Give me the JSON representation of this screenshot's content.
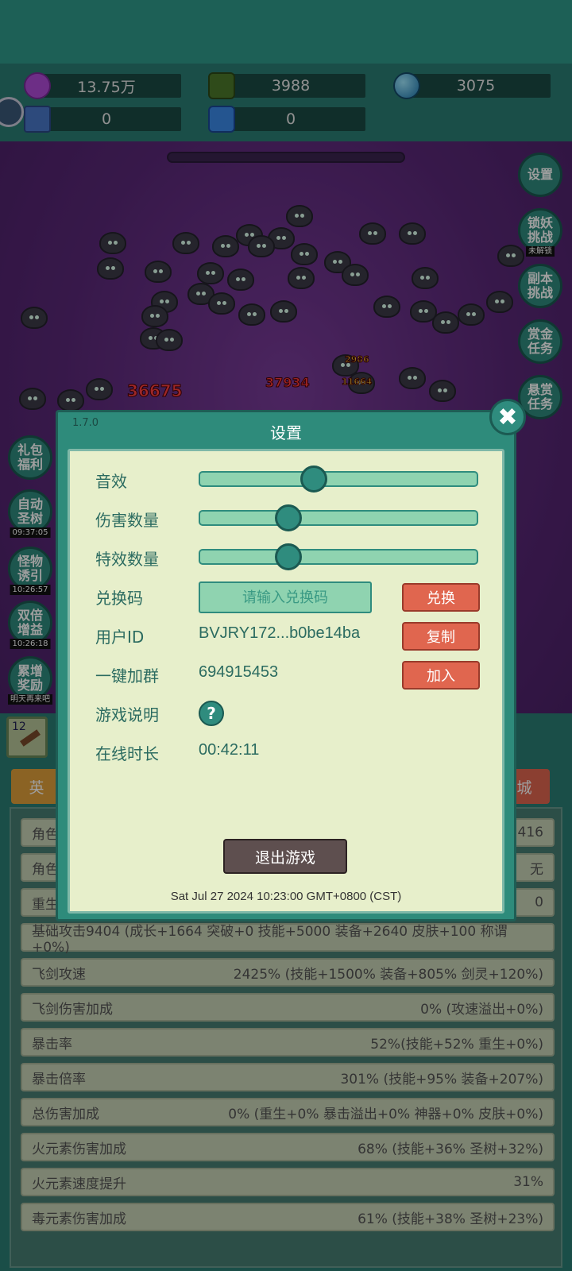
{
  "resources": {
    "gem": "13.75万",
    "green_crystal": "3988",
    "orb": "3075",
    "ticket": "0",
    "blue_crystal": "0"
  },
  "right_buttons": [
    {
      "label": "设置",
      "sub": ""
    },
    {
      "label": "锁妖\n挑战",
      "sub": "未解锁"
    },
    {
      "label": "副本\n挑战",
      "sub": ""
    },
    {
      "label": "赏金\n任务",
      "sub": ""
    },
    {
      "label": "悬赏\n任务",
      "sub": ""
    }
  ],
  "left_buttons": [
    {
      "label": "礼包\n福利",
      "sub": ""
    },
    {
      "label": "自动\n圣树",
      "sub": "09:37:05"
    },
    {
      "label": "怪物\n诱引",
      "sub": "10:26:57"
    },
    {
      "label": "双倍\n增益",
      "sub": "10:26:18"
    },
    {
      "label": "累增\n奖励",
      "sub": "明天再来吧"
    }
  ],
  "damage_numbers": [
    "36675",
    "37934",
    "11664",
    "2986"
  ],
  "tabs": {
    "left": "英",
    "right": "城"
  },
  "stats": [
    {
      "label": "角色",
      "value": "416"
    },
    {
      "label": "角色",
      "value": "无"
    },
    {
      "label": "重生次数",
      "value": "0"
    },
    {
      "label": "基础攻击9404 (成长+1664 突破+0 技能+5000 装备+2640 皮肤+100 称谓+0%)",
      "value": ""
    },
    {
      "label": "飞剑攻速",
      "value": "2425% (技能+1500% 装备+805% 剑灵+120%)"
    },
    {
      "label": "飞剑伤害加成",
      "value": "0% (攻速溢出+0%)"
    },
    {
      "label": "暴击率",
      "value": "52%(技能+52% 重生+0%)"
    },
    {
      "label": "暴击倍率",
      "value": "301% (技能+95% 装备+207%)"
    },
    {
      "label": "总伤害加成",
      "value": "0% (重生+0% 暴击溢出+0% 神器+0% 皮肤+0%)"
    },
    {
      "label": "火元素伤害加成",
      "value": "68% (技能+36% 圣树+32%)"
    },
    {
      "label": "火元素速度提升",
      "value": "31%"
    },
    {
      "label": "毒元素伤害加成",
      "value": "61% (技能+38% 圣树+23%)"
    }
  ],
  "dialog": {
    "version": "1.7.0",
    "title": "设置",
    "sound_label": "音效",
    "sound_level": 0.4,
    "damage_count_label": "伤害数量",
    "damage_count_level": 0.3,
    "effect_count_label": "特效数量",
    "effect_count_level": 0.3,
    "redeem_label": "兑换码",
    "redeem_placeholder": "请输入兑换码",
    "redeem_button": "兑换",
    "user_id_label": "用户ID",
    "user_id_value": "BVJRY172...b0be14ba",
    "copy_button": "复制",
    "group_label": "一键加群",
    "group_value": "694915453",
    "join_button": "加入",
    "guide_label": "游戏说明",
    "help_symbol": "?",
    "online_label": "在线时长",
    "online_value": "00:42:11",
    "exit_button": "退出游戏",
    "datetime": "Sat Jul 27 2024 10:23:00 GMT+0800 (CST)",
    "close_symbol": "✖"
  },
  "colors": {
    "accent": "#2f8c7e",
    "red_button": "#e0664f",
    "panel": "#e7efcb"
  }
}
